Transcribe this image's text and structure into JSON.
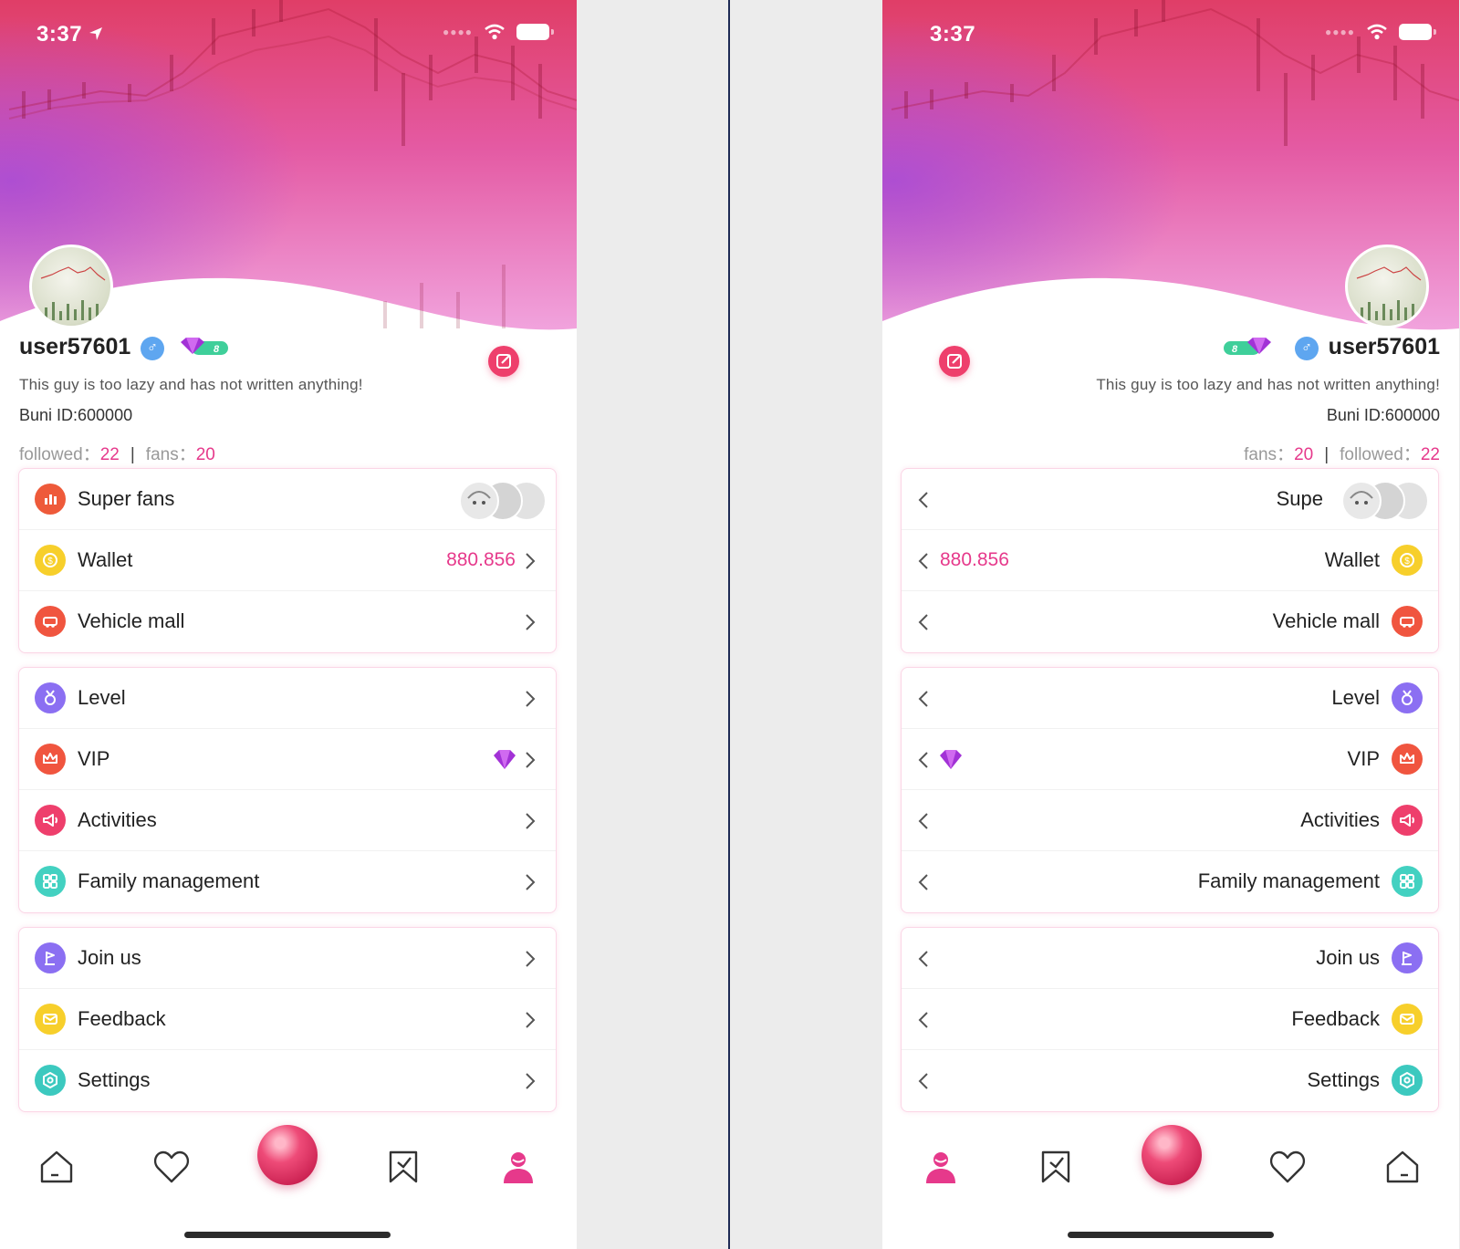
{
  "status_bar": {
    "time": "3:37"
  },
  "profile": {
    "username": "user57601",
    "gender_symbol": "♂",
    "vip_level": "8",
    "bio": "This guy is too lazy and has not written anything!",
    "id_text": "Buni ID:600000",
    "followed_label": "followed：",
    "followed_count": "22",
    "fans_label": "fans：",
    "fans_count": "20",
    "separator": "|"
  },
  "menu": {
    "super_fans": "Super fans",
    "super_fans_truncated": "Supe",
    "wallet": "Wallet",
    "wallet_value": "880.856",
    "vehicle_mall": "Vehicle mall",
    "level": "Level",
    "vip": "VIP",
    "activities": "Activities",
    "family_management": "Family management",
    "join_us": "Join us",
    "feedback": "Feedback",
    "settings": "Settings"
  },
  "colors": {
    "accent_pink": "#e6398b",
    "edit_red": "#ee3f6c",
    "super_fans_icon": "#ee5a3a",
    "wallet_icon": "#f7cf2b",
    "vehicle_icon": "#f0553f",
    "level_icon": "#8b6ff2",
    "vip_icon": "#f0553f",
    "activities_icon": "#ee3f6c",
    "family_icon": "#43d1c1",
    "join_icon": "#8b6ff2",
    "feedback_icon": "#f7cf2b",
    "settings_icon": "#3cc9bf"
  },
  "icons": {
    "super_fans": "bar-chart-icon",
    "wallet": "coin-icon",
    "vehicle_mall": "car-icon",
    "level": "medal-icon",
    "vip": "crown-icon",
    "activities": "megaphone-icon",
    "family_management": "grid-icon",
    "join_us": "flag-icon",
    "feedback": "envelope-icon",
    "settings": "gear-icon",
    "tabs": [
      "home-icon",
      "heart-icon",
      "live-orb-icon",
      "bookmark-icon",
      "profile-icon"
    ]
  }
}
